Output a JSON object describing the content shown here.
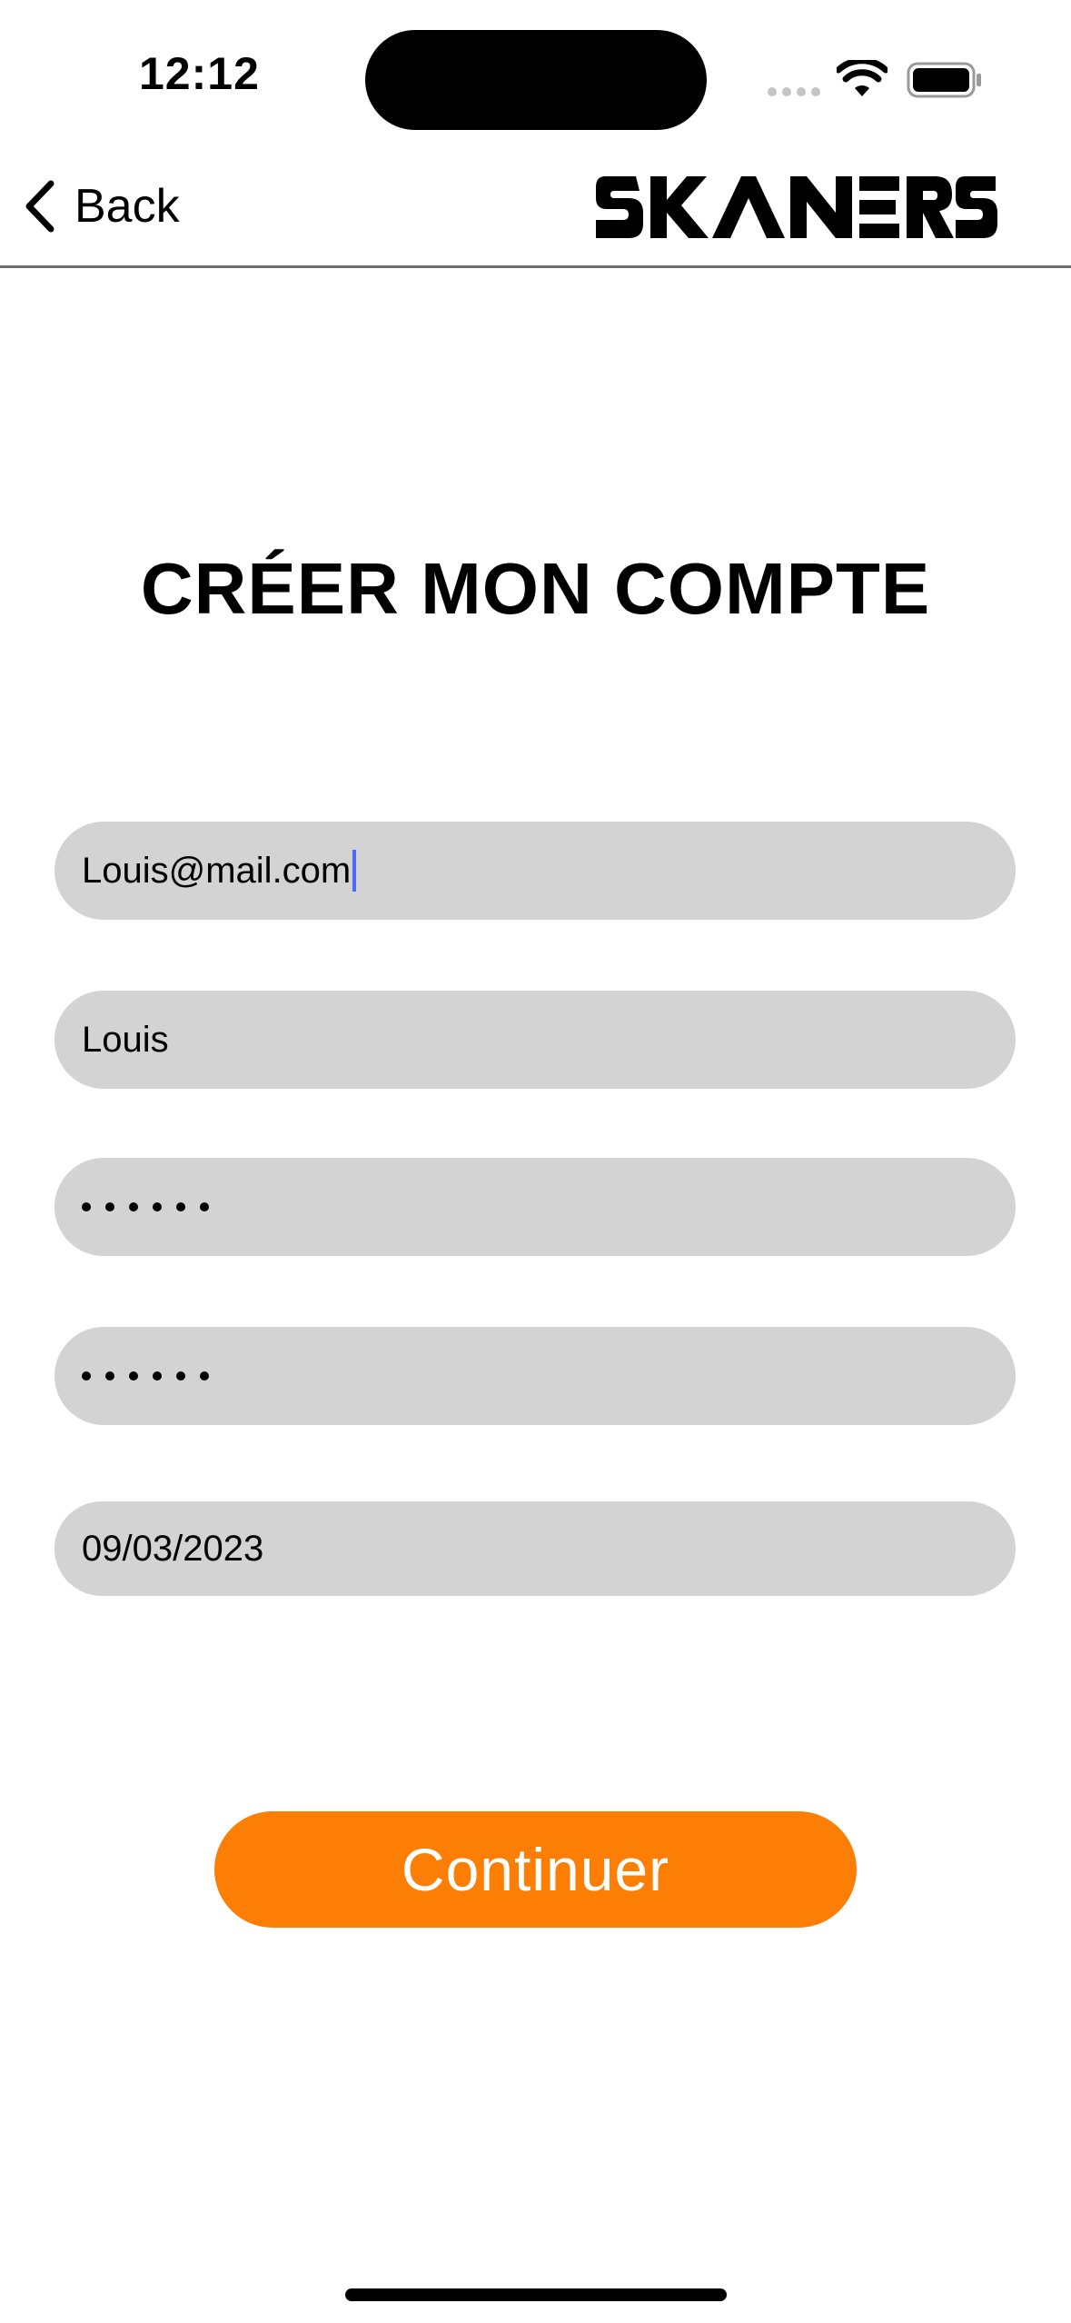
{
  "status_bar": {
    "time": "12:12"
  },
  "nav": {
    "back_label": "Back",
    "logo_text": "SKANERS"
  },
  "form": {
    "title": "CRÉER MON COMPTE",
    "email_value": "Louis@mail.com",
    "name_value": "Louis",
    "password_length": 6,
    "confirm_password_length": 6,
    "date_value": "09/03/2023"
  },
  "actions": {
    "continue_label": "Continuer"
  },
  "colors": {
    "accent": "#fd7e05",
    "field_bg": "#d3d3d3",
    "caret": "#4a6cf7"
  }
}
